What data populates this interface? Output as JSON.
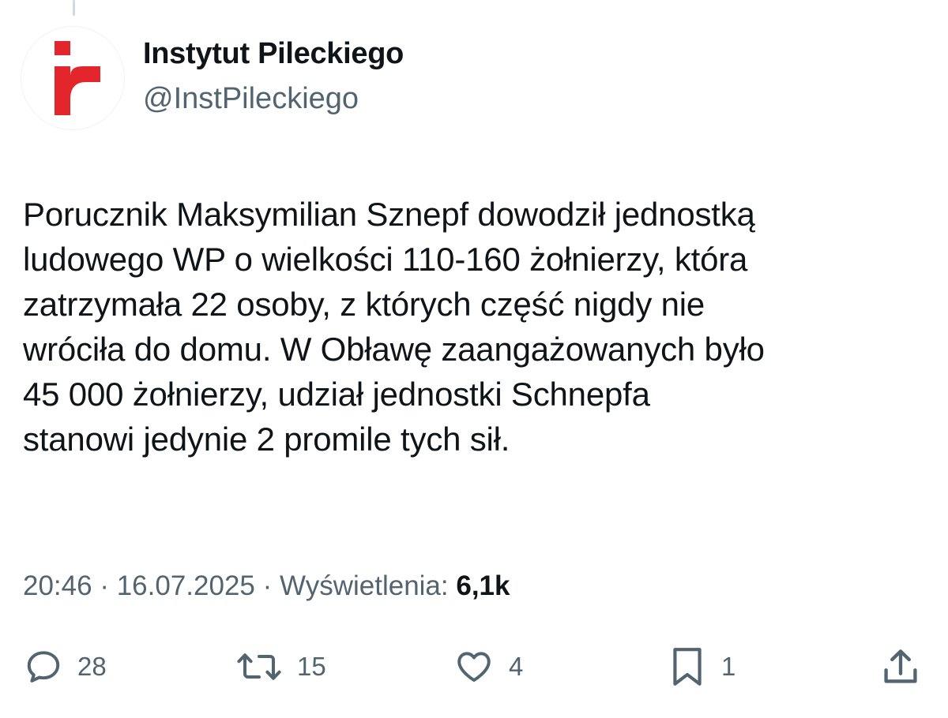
{
  "author": {
    "display_name": "Instytut Pileckiego",
    "handle": "@InstPileckiego",
    "avatar_icon": "instytut-pileckiego-logo",
    "brand_color": "#e3262c"
  },
  "tweet": {
    "lines": [
      "Porucznik Maksymilian Sznepf dowodził jednostką",
      "ludowego WP o wielkości 110-160 żołnierzy, która",
      "zatrzymała 22 osoby, z których część nigdy nie",
      "wróciła do domu. W Obławę zaangażowanych było",
      "45 000 żołnierzy, udział jednostki Schnepfa",
      "stanowi jedynie 2 promile tych sił."
    ]
  },
  "meta": {
    "time": "20:46",
    "separator": " · ",
    "date": "16.07.2025",
    "views_label": "Wyświetlenia:",
    "views_count": "6,1k"
  },
  "actions": {
    "reply": {
      "icon": "reply-icon",
      "count": "28"
    },
    "repost": {
      "icon": "repost-icon",
      "count": "15"
    },
    "like": {
      "icon": "heart-icon",
      "count": "4"
    },
    "bookmark": {
      "icon": "bookmark-icon",
      "count": "1"
    },
    "share": {
      "icon": "share-icon"
    }
  },
  "colors": {
    "text": "#0f1419",
    "secondary": "#536471",
    "background": "#ffffff"
  }
}
